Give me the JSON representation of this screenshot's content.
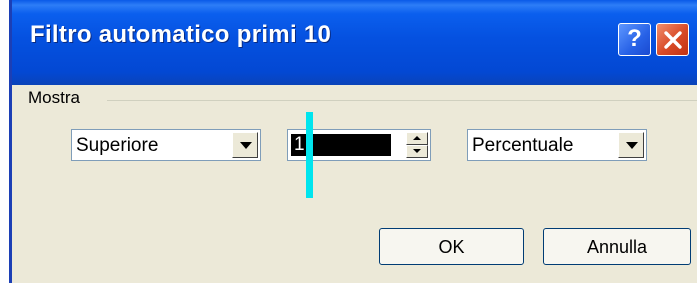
{
  "window": {
    "title": "Filtro automatico primi 10",
    "help_glyph": "?",
    "help_icon": "help-question-icon",
    "close_icon": "close-x-icon",
    "colors": {
      "titlebar": "#0551e0",
      "client": "#ece9d8",
      "close": "#d84a26"
    }
  },
  "group": {
    "label": "Mostra"
  },
  "controls": {
    "top_bottom": {
      "selected": "Superiore"
    },
    "count": {
      "value": "1"
    },
    "unit": {
      "selected": "Percentuale"
    }
  },
  "buttons": {
    "ok": "OK",
    "cancel": "Annulla"
  },
  "marker_color": "#00e5ee"
}
